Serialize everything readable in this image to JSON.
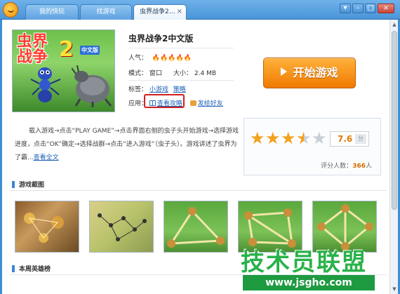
{
  "tabs": [
    {
      "label": "我的快玩",
      "active": false
    },
    {
      "label": "找游戏",
      "active": false
    },
    {
      "label": "虫界战争2…",
      "active": true
    }
  ],
  "window_buttons": {
    "dropdown": "▾",
    "minimize": "–",
    "maximize": "□",
    "close": "×"
  },
  "tab_close": "×",
  "cover": {
    "title": "虫界",
    "title2": "战争",
    "num": "2",
    "sub": "中文版"
  },
  "game": {
    "title": "虫界战争2中文版",
    "popularity_label": "人气：",
    "popularity_level": 5,
    "mode_label": "模式：",
    "mode_value": "窗口",
    "size_label": "大小：",
    "size_value": "2.4 MB",
    "tags_label": "标签：",
    "tags": [
      "小游戏",
      "策略"
    ],
    "apps_label": "应用：",
    "guide_link": "查看攻略",
    "share_link": "发给好友"
  },
  "start_button": "开始游戏",
  "rating": {
    "score": "7.6",
    "unit": "分",
    "stars_full": 3,
    "stars_half": 1,
    "stars_total": 5,
    "count_label": "评分人数：",
    "count": "366",
    "count_unit": "人"
  },
  "description": {
    "text": "载入游戏→点击“PLAY GAME”→点击界面右侧的虫子头开始游戏→选择游戏进度，点击“OK”确定→选择战群→点击“进入游戏”（虫子头）。游戏讲述了虫界为了霸...",
    "more": "查看全文"
  },
  "sections": {
    "screenshots": "游戏截图",
    "heroes": "本周英雄榜"
  },
  "watermark": {
    "big": "技术员联盟",
    "url": "www.jsgho.com"
  },
  "colors": {
    "accent": "#3b86d6",
    "start": "#f07a00",
    "highlight": "#d21f1f",
    "watermark": "#29b24a"
  }
}
